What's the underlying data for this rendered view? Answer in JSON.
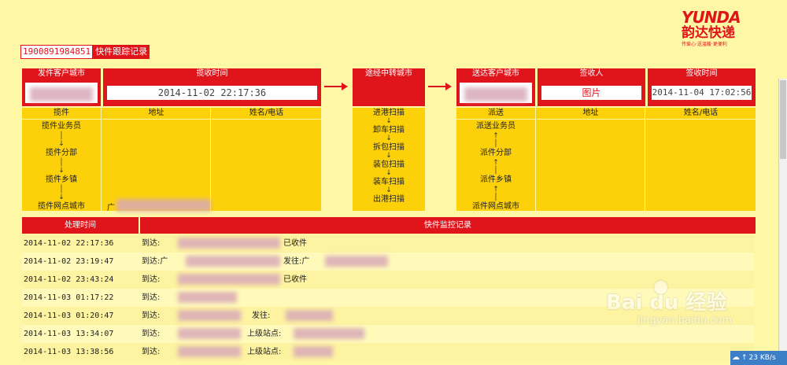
{
  "brand": {
    "name": "YUNDA",
    "cn_name": "韵达快递",
    "slogan": "传爱心·送温暖·更便利"
  },
  "tracking": {
    "number": "1900891984851",
    "title": "快件跟踪记录"
  },
  "left_panel": {
    "h_city": "发件客户城市",
    "h_time": "揽收时间",
    "collect_time": "2014-11-02 22:17:36",
    "sub_pickup": "揽件",
    "sub_address": "地址",
    "sub_name": "姓名/电话",
    "flow": [
      "揽件业务员",
      "揽件分部",
      "揽件乡镇",
      "揽件网点城市"
    ],
    "addr_partial": "广"
  },
  "mid_panel": {
    "h_transit": "途经中转城市",
    "flow": [
      "进港扫描",
      "卸车扫描",
      "拆包扫描",
      "装包扫描",
      "装车扫描",
      "出港扫描"
    ]
  },
  "right_panel": {
    "h_city": "送达客户城市",
    "h_sign": "签收人",
    "h_time": "签收时间",
    "signer": "图片",
    "sign_time": "2014-11-04 17:02:56",
    "sub_dispatch": "派送",
    "sub_address": "地址",
    "sub_name": "姓名/电话",
    "flow": [
      "派送业务员",
      "派件分部",
      "派件乡镇",
      "派件网点城市"
    ]
  },
  "records": {
    "h_time": "处理时间",
    "h_log": "快件监控记录",
    "rows": [
      {
        "time": "2014-11-02 22:17:36",
        "desc": "到达:",
        "suffix": "已收件"
      },
      {
        "time": "2014-11-02 23:19:47",
        "desc": "到达:广",
        "suffix": "发往:广"
      },
      {
        "time": "2014-11-02 23:43:24",
        "desc": "到达:",
        "suffix": "已收件"
      },
      {
        "time": "2014-11-03 01:17:22",
        "desc": "到达:",
        "suffix": ""
      },
      {
        "time": "2014-11-03 01:20:47",
        "desc": "到达:",
        "suffix": "发往:"
      },
      {
        "time": "2014-11-03 13:34:07",
        "desc": "到达:",
        "suffix": "上级站点:"
      },
      {
        "time": "2014-11-03 13:38:56",
        "desc": "到达:",
        "suffix": "上级站点:"
      }
    ]
  },
  "watermark": {
    "text": "Bai du 经验",
    "url": "jingyan.baidu.com"
  },
  "status": {
    "speed": "23 KB/s"
  }
}
